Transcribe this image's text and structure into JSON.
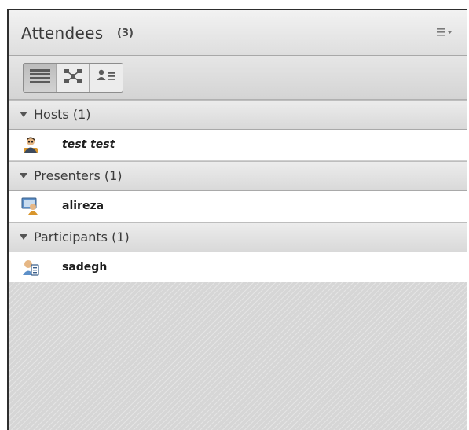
{
  "header": {
    "title": "Attendees",
    "count": "(3)",
    "menu_icon": "menu-options-icon"
  },
  "toolbar": {
    "views": [
      {
        "name": "list-view",
        "icon": "list-view-icon",
        "active": true
      },
      {
        "name": "breakout-view",
        "icon": "breakout-view-icon",
        "active": false
      },
      {
        "name": "status-view",
        "icon": "status-view-icon",
        "active": false
      }
    ]
  },
  "sections": [
    {
      "label": "Hosts (1)",
      "attendees": [
        {
          "name": "test test",
          "role": "host",
          "icon": "host-user-icon"
        }
      ]
    },
    {
      "label": "Presenters (1)",
      "attendees": [
        {
          "name": "alireza",
          "role": "presenter",
          "icon": "presenter-user-icon"
        }
      ]
    },
    {
      "label": "Participants (1)",
      "attendees": [
        {
          "name": "sadegh",
          "role": "participant",
          "icon": "participant-user-icon"
        }
      ]
    }
  ],
  "colors": {
    "panel_bg": "#dcdcdc",
    "border_dark": "#2e2e2e",
    "host_accent": "#d9962c",
    "presenter_accent": "#5c8fc8"
  }
}
